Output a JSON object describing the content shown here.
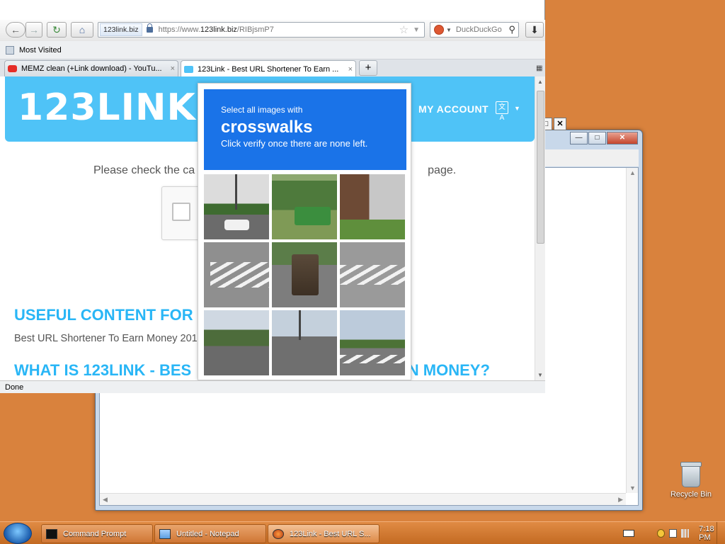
{
  "desktop": {
    "recycle_bin_label": "Recycle Bin"
  },
  "firefox": {
    "url_site_identity": "123link.biz",
    "url_prefix": "https://www.",
    "url_domain": "123link.biz",
    "url_path": "/RIBjsmP7",
    "search_engine": "DuckDuckGo",
    "bookmark_label": "Most Visited",
    "tabs": [
      {
        "label": "MEMZ clean (+Link download) - YouTu...",
        "close": "×"
      },
      {
        "label": "123Link - Best URL Shortener To Earn ...",
        "close": "×"
      }
    ],
    "new_tab_label": "+",
    "status": "Done"
  },
  "site": {
    "logo": "123LINK",
    "my_account": "MY ACCOUNT",
    "lang_icon": "文A",
    "notice_text": "Please check the ca                                                                          page.",
    "heading_useful": "USEFUL CONTENT FOR",
    "body_text": "Best URL Shortener To Earn Money 201                                                biggest money.",
    "heading_what": "WHAT IS 123LINK - BES                                                  N MONEY?"
  },
  "captcha": {
    "instruction_small": "Select all images with",
    "target_word": "crosswalks",
    "instruction_sub": "Click verify once there are none left."
  },
  "notepad": {
    "minimize": "—",
    "maximize": "□",
    "close": "✕"
  },
  "taskbar": {
    "tasks": [
      {
        "label": "Command Prompt"
      },
      {
        "label": "Untitled - Notepad"
      },
      {
        "label": "123Link - Best URL S..."
      }
    ],
    "clock": "7:18 PM"
  },
  "colors": {
    "desktop": "#d9823d",
    "site_accent": "#4fc3f7",
    "heading": "#29b6f6",
    "captcha_header": "#1a73e8"
  }
}
